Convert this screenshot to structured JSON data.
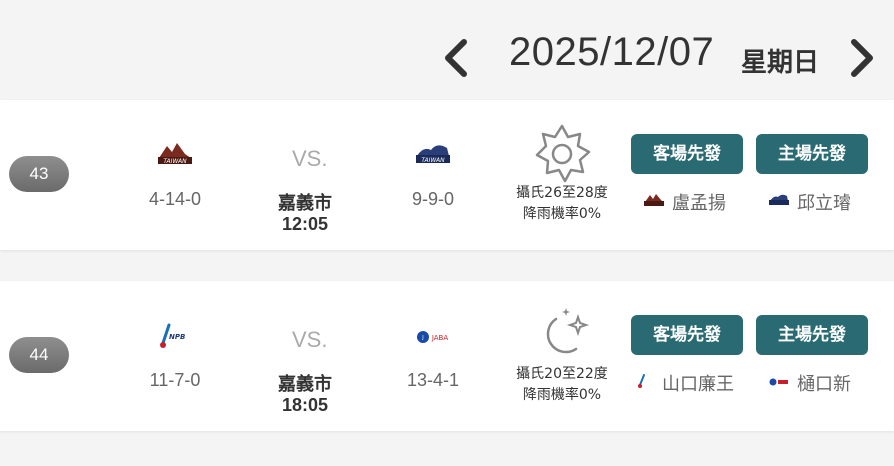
{
  "date_nav": {
    "date": "2025/12/07",
    "weekday": "星期日",
    "prev_icon": "chevron-left-icon",
    "next_icon": "chevron-right-icon"
  },
  "colors": {
    "accent": "#2a6b73",
    "badge": "#7a7a7a",
    "background": "#f4f4f4"
  },
  "games": [
    {
      "number": "43",
      "away": {
        "logo_icon": "taiwan-team-logo-icon",
        "record": "4-14-0"
      },
      "vs": "VS.",
      "venue": "嘉義市",
      "time": "12:05",
      "home": {
        "logo_icon": "taiwan-team-logo-icon",
        "record": "9-9-0"
      },
      "weather": {
        "icon": "sun-icon",
        "temp": "攝氏26至28度",
        "rain": "降雨機率0%"
      },
      "away_starter_label": "客場先發",
      "home_starter_label": "主場先發",
      "away_pitcher": "盧孟揚",
      "home_pitcher": "邱立璿"
    },
    {
      "number": "44",
      "away": {
        "logo_icon": "npb-logo-icon",
        "record": "11-7-0"
      },
      "vs": "VS.",
      "venue": "嘉義市",
      "time": "18:05",
      "home": {
        "logo_icon": "jaba-logo-icon",
        "record": "13-4-1"
      },
      "weather": {
        "icon": "moon-stars-icon",
        "temp": "攝氏20至22度",
        "rain": "降雨機率0%"
      },
      "away_starter_label": "客場先發",
      "home_starter_label": "主場先發",
      "away_pitcher": "山口廉王",
      "home_pitcher": "樋口新"
    }
  ]
}
